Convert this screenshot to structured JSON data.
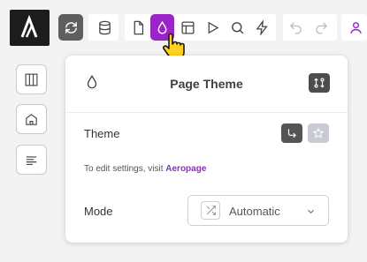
{
  "toolbar": {
    "logo_glyph": "A",
    "icons": [
      "sync-icon",
      "database-icon",
      "document-icon",
      "drop-icon",
      "layout-icon",
      "play-icon",
      "search-icon",
      "lightning-icon",
      "undo-icon",
      "redo-icon"
    ],
    "active_color": "#9b24c9"
  },
  "sidebar": {
    "icons": [
      "columns-icon",
      "home-icon",
      "text-align-icon"
    ]
  },
  "panel": {
    "title": "Page Theme",
    "theme_label": "Theme",
    "hint_prefix": "To edit settings, visit ",
    "hint_link": "Aeropage",
    "mode_label": "Mode",
    "mode_value": "Automatic"
  }
}
